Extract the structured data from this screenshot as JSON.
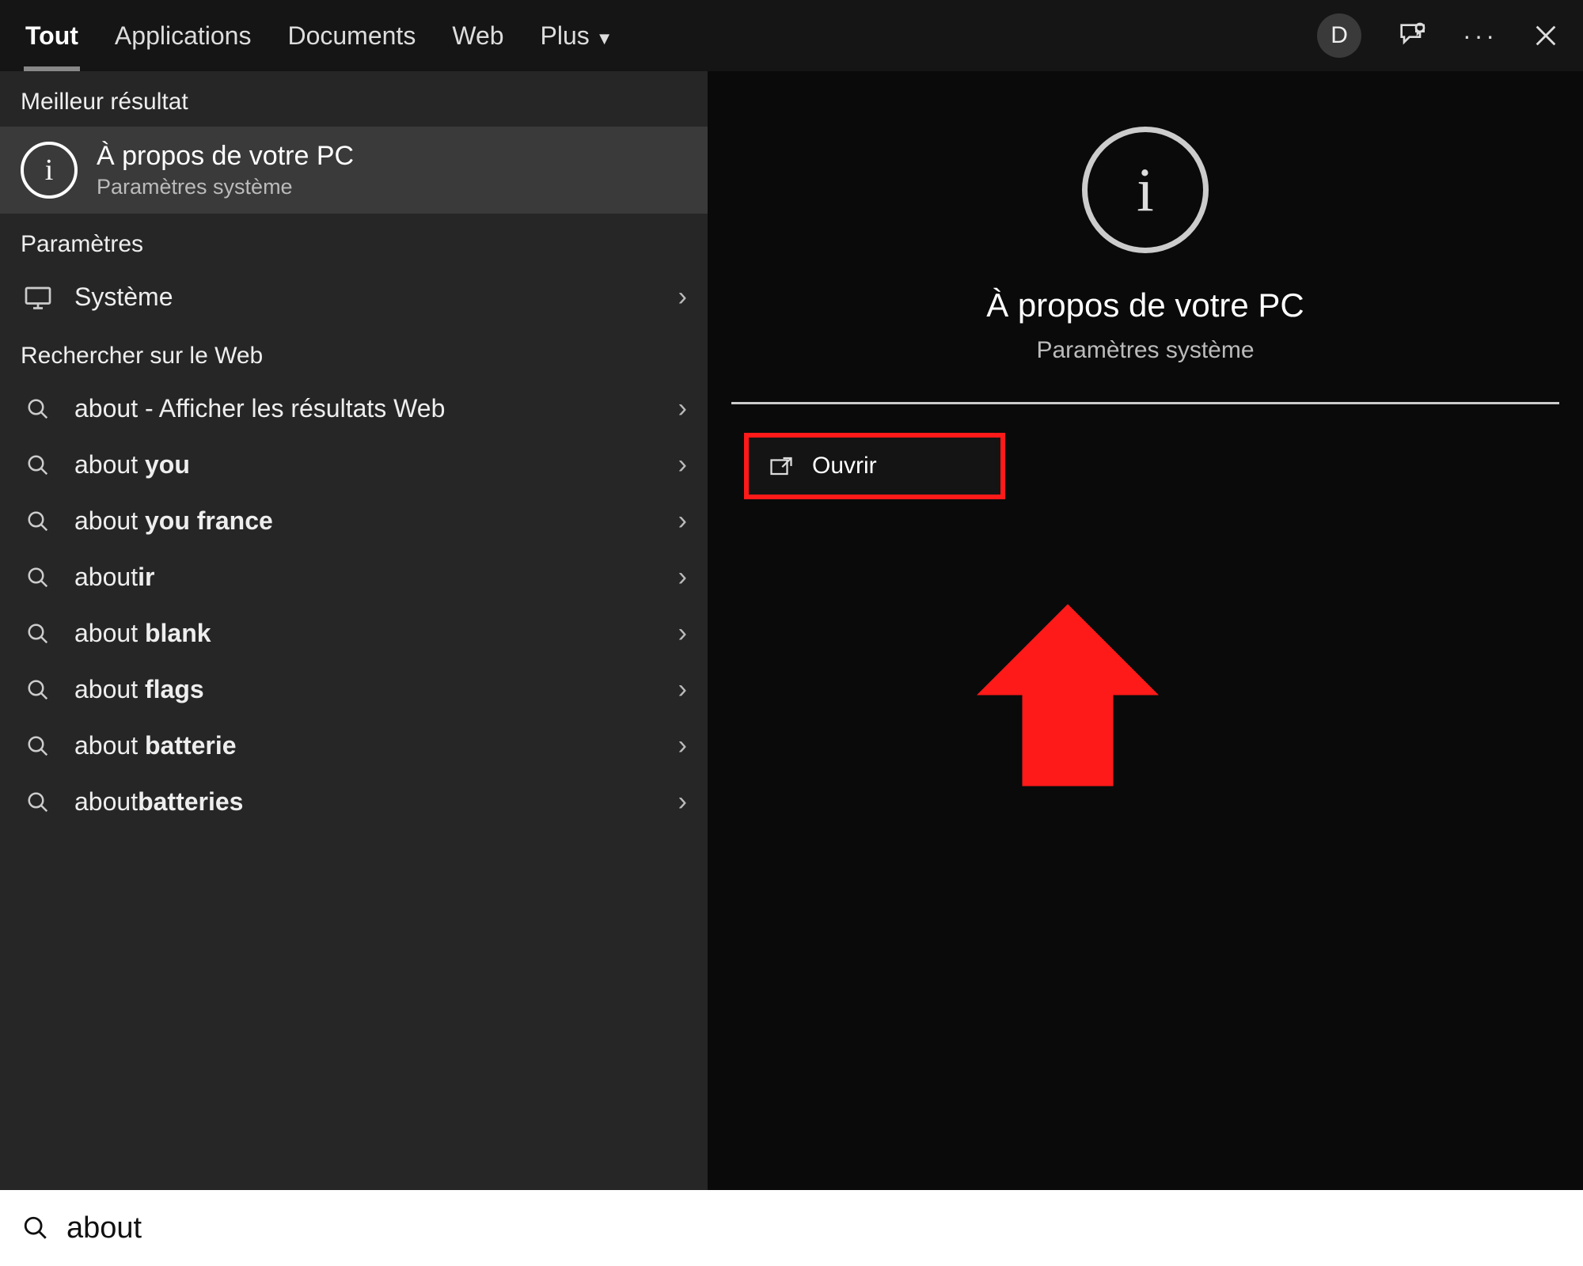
{
  "tabs": {
    "items": [
      {
        "label": "Tout",
        "active": true
      },
      {
        "label": "Applications",
        "active": false
      },
      {
        "label": "Documents",
        "active": false
      },
      {
        "label": "Web",
        "active": false
      },
      {
        "label": "Plus",
        "active": false,
        "dropdown": true
      }
    ],
    "avatar_letter": "D"
  },
  "left": {
    "best_header": "Meilleur résultat",
    "best": {
      "title": "À propos de votre PC",
      "sub": "Paramètres système"
    },
    "settings_header": "Paramètres",
    "settings_item": {
      "label": "Système"
    },
    "web_header": "Rechercher sur le Web",
    "web_items": [
      {
        "prefix": "about",
        "suffix": " - Afficher les résultats Web"
      },
      {
        "prefix": "about ",
        "bold": "you"
      },
      {
        "prefix": "about ",
        "bold": "you france"
      },
      {
        "prefix": "about",
        "bold": "ir"
      },
      {
        "prefix": "about ",
        "bold": "blank"
      },
      {
        "prefix": "about ",
        "bold": "flags"
      },
      {
        "prefix": "about ",
        "bold": "batterie"
      },
      {
        "prefix": "about",
        "bold": "batteries"
      }
    ]
  },
  "right": {
    "title": "À propos de votre PC",
    "sub": "Paramètres système",
    "open_label": "Ouvrir"
  },
  "search_query": "about"
}
